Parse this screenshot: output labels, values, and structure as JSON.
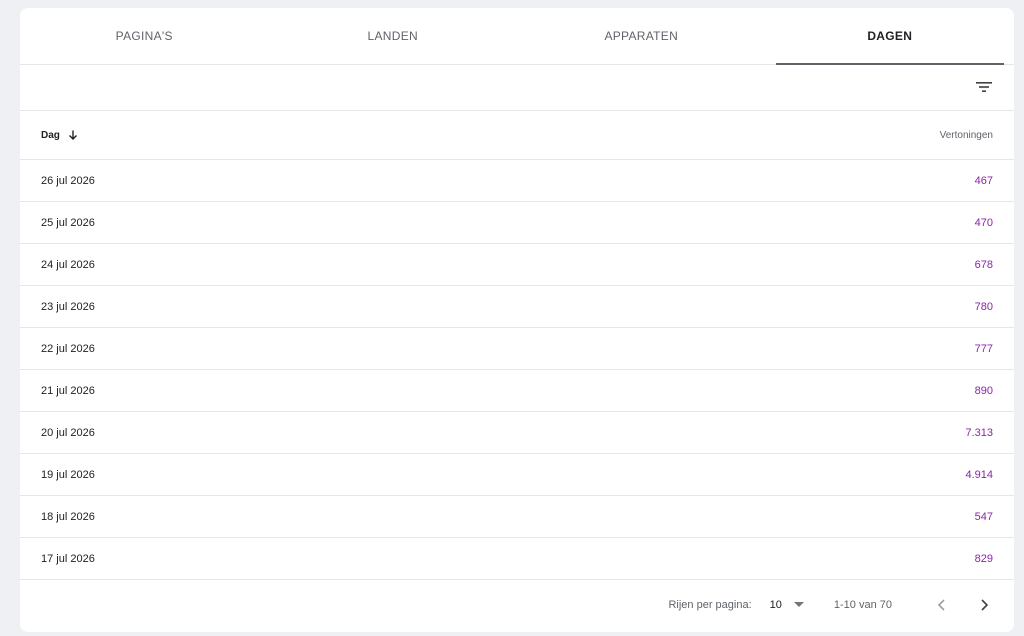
{
  "tabs": [
    {
      "label": "PAGINA'S"
    },
    {
      "label": "LANDEN"
    },
    {
      "label": "APPARATEN"
    },
    {
      "label": "DAGEN"
    }
  ],
  "active_tab": "DAGEN",
  "table": {
    "columns": {
      "day": "Dag",
      "views": "Vertoningen"
    },
    "rows": [
      {
        "day": "26 jul 2026",
        "views": "467"
      },
      {
        "day": "25 jul 2026",
        "views": "470"
      },
      {
        "day": "24 jul 2026",
        "views": "678"
      },
      {
        "day": "23 jul 2026",
        "views": "780"
      },
      {
        "day": "22 jul 2026",
        "views": "777"
      },
      {
        "day": "21 jul 2026",
        "views": "890"
      },
      {
        "day": "20 jul 2026",
        "views": "7.313"
      },
      {
        "day": "19 jul 2026",
        "views": "4.914"
      },
      {
        "day": "18 jul 2026",
        "views": "547"
      },
      {
        "day": "17 jul 2026",
        "views": "829"
      }
    ]
  },
  "footer": {
    "rows_per_page_label": "Rijen per pagina:",
    "rows_per_page_value": "10",
    "range": "1-10 van 70"
  },
  "colors": {
    "value_accent": "#8e24aa",
    "active_tab_underline": "#5f6368"
  },
  "icons": {
    "filter": "filter-icon",
    "sort": "arrow-down-icon",
    "dropdown": "caret-down-icon",
    "prev": "chevron-left-icon",
    "next": "chevron-right-icon"
  }
}
